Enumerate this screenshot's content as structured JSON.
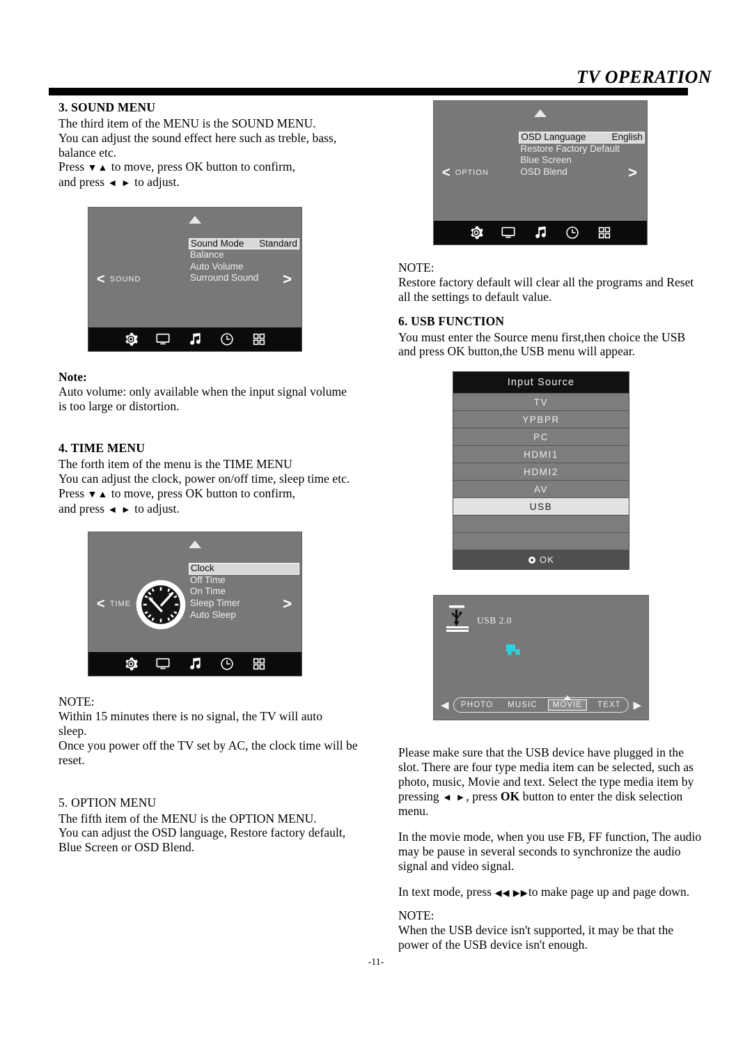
{
  "header": {
    "title": "TV OPERATION"
  },
  "footer": {
    "page_number": "-11-"
  },
  "left_column": {
    "sound_menu": {
      "heading": "3. SOUND MENU",
      "para1": "The third item of the MENU is the SOUND MENU.",
      "para2": "You can adjust the sound effect here such as treble, bass, balance etc.",
      "press_prefix": "Press",
      "press_mid": "to move, press OK button to confirm,",
      "press_suffix": "and press",
      "press_end": "to adjust.",
      "arrows_vertical": "▼▲",
      "arrows_horizontal": "◄ ►"
    },
    "sound_osd": {
      "left_label": "SOUND",
      "left_chevron": "<",
      "right_chevron": ">",
      "items": [
        {
          "label": "Sound Mode",
          "value": "Standard",
          "selected": true
        },
        {
          "label": "Balance",
          "value": "",
          "selected": false
        },
        {
          "label": "Auto Volume",
          "value": "",
          "selected": false
        },
        {
          "label": "Surround Sound",
          "value": "",
          "selected": false
        }
      ],
      "bottom_icons": [
        "gear-icon",
        "monitor-icon",
        "music-note-icon",
        "clock-icon",
        "grid-icon"
      ]
    },
    "note_sound": {
      "heading": "Note:",
      "text": "Auto volume: only available when the input signal volume is too large or distortion."
    },
    "time_menu": {
      "heading": "4. TIME MENU",
      "para1": "The forth item of the menu is the TIME MENU",
      "para2": "You can adjust the clock, power on/off time, sleep time etc.",
      "press_prefix": "Press",
      "press_mid": "to move, press OK button to confirm,",
      "press_suffix": "and press",
      "press_end": "to adjust.",
      "arrows_vertical": "▼▲",
      "arrows_horizontal": "◄ ►"
    },
    "time_osd": {
      "left_label": "TIME",
      "left_chevron": "<",
      "right_chevron": ">",
      "items": [
        {
          "label": "Clock",
          "value": "",
          "selected": true
        },
        {
          "label": "Off Time",
          "value": "",
          "selected": false
        },
        {
          "label": "On Time",
          "value": "",
          "selected": false
        },
        {
          "label": "Sleep Timer",
          "value": "",
          "selected": false
        },
        {
          "label": "Auto Sleep",
          "value": "",
          "selected": false
        }
      ],
      "bottom_icons": [
        "gear-icon",
        "monitor-icon",
        "music-note-icon",
        "clock-icon",
        "grid-icon"
      ]
    },
    "note_time": {
      "heading": "NOTE:",
      "text1": "Within 15 minutes there is no signal, the TV will auto sleep.",
      "text2": "Once you power off the TV set by AC, the clock time will be reset."
    },
    "option_menu": {
      "heading": "5. OPTION MENU",
      "para1": "The fifth item of the MENU is the OPTION MENU.",
      "para2": "You can adjust the OSD language, Restore factory default, Blue Screen or OSD Blend."
    }
  },
  "right_column": {
    "option_osd": {
      "left_label": "OPTION",
      "left_chevron": "<",
      "right_chevron": ">",
      "items": [
        {
          "label": "OSD Language",
          "value": "English",
          "selected": true
        },
        {
          "label": "Restore Factory Default",
          "value": "",
          "selected": false
        },
        {
          "label": "Blue Screen",
          "value": "",
          "selected": false
        },
        {
          "label": "OSD Blend",
          "value": "",
          "selected": false
        }
      ],
      "bottom_icons": [
        "gear-icon",
        "monitor-icon",
        "music-note-icon",
        "clock-icon",
        "grid-icon"
      ]
    },
    "note_option": {
      "heading": "NOTE:",
      "text": "Restore factory default will clear all the programs and Reset all the settings to default value."
    },
    "usb_function": {
      "heading": "6. USB FUNCTION",
      "para1": "You must enter the Source menu first,then choice the USB and press OK button,the USB menu will appear."
    },
    "input_source": {
      "title": "Input Source",
      "ok_label": "OK",
      "rows": [
        {
          "label": "TV",
          "selected": false
        },
        {
          "label": "YPBPR",
          "selected": false
        },
        {
          "label": "PC",
          "selected": false
        },
        {
          "label": "HDMI1",
          "selected": false
        },
        {
          "label": "HDMI2",
          "selected": false
        },
        {
          "label": "AV",
          "selected": false
        },
        {
          "label": "USB",
          "selected": true
        },
        {
          "label": "",
          "selected": false
        },
        {
          "label": "",
          "selected": false
        }
      ]
    },
    "usb_screen": {
      "device_label": "USB 2.0",
      "left_arrow": "◀",
      "right_arrow": "▶",
      "media_items": [
        {
          "label": "PHOTO",
          "selected": false
        },
        {
          "label": "MUSIC",
          "selected": false
        },
        {
          "label": "MOVIE",
          "selected": true
        },
        {
          "label": "TEXT",
          "selected": false
        }
      ],
      "drive_color": "#29d3e0"
    },
    "usb_notes": {
      "para1_a": "Please make sure that the USB device have plugged in the slot. There are four type media item can be selected, such as photo, music, Movie and text. Select the type media item by pressing",
      "arrows_horizontal": "◄ ►",
      "para1_b": ", press",
      "ok_bold": "OK",
      "para1_c": "button to enter the disk selection menu.",
      "para2": "In the movie mode, when you use FB, FF function, The audio may be pause in several seconds to synchronize the audio signal and video signal.",
      "para3_a": "In text mode, press",
      "para3_arrows": "◀◀  ▶▶",
      "para3_b": "to make page up and page down.",
      "note_heading": "NOTE:",
      "note_text": "When the USB device isn't supported, it may be that the power of the USB device isn't enough."
    }
  }
}
